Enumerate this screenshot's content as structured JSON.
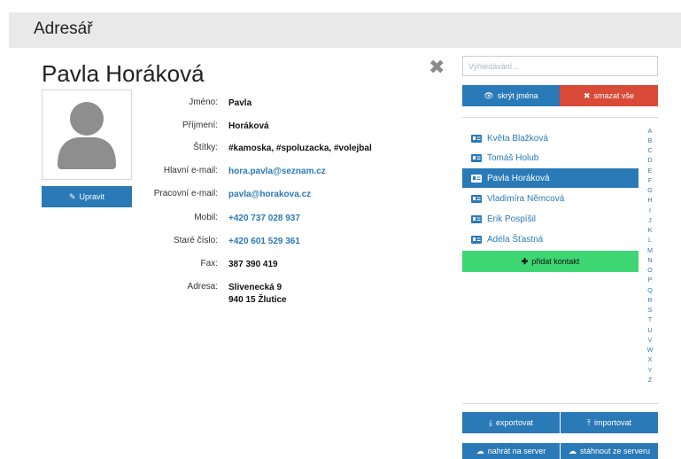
{
  "header": {
    "title": "Adresář"
  },
  "contact": {
    "name": "Pavla Horáková",
    "edit_label": "Upravit",
    "fields": [
      {
        "label": "Jméno:",
        "value": "Pavla",
        "link": false
      },
      {
        "label": "Příjmení:",
        "value": "Horáková",
        "link": false
      },
      {
        "label": "Štítky:",
        "value": "#kamoska, #spoluzacka, #volejbal",
        "link": false
      },
      {
        "label": "Hlavní e-mail:",
        "value": "hora.pavla@seznam.cz",
        "link": true
      },
      {
        "label": "Pracovní e-mail:",
        "value": "pavla@horakova.cz",
        "link": true
      },
      {
        "label": "Mobil:",
        "value": "+420 737 028 937",
        "link": true
      },
      {
        "label": "Staré číslo:",
        "value": "+420 601 529 361",
        "link": true
      },
      {
        "label": "Fax:",
        "value": "387 390 419",
        "link": false
      },
      {
        "label": "Adresa:",
        "value": "Slivenecká 9",
        "value2": "940 15 Žlutice",
        "link": false
      }
    ]
  },
  "sidebar": {
    "search_placeholder": "Vyhledávání...",
    "hide_names_label": "skrýt jména",
    "delete_all_label": "smazat vše",
    "contacts": [
      {
        "name": "Květa Blažková",
        "active": false
      },
      {
        "name": "Tomáš Holub",
        "active": false
      },
      {
        "name": "Pavla Horáková",
        "active": true
      },
      {
        "name": "Vladimíra Němcová",
        "active": false
      },
      {
        "name": "Erik Pospíšil",
        "active": false
      },
      {
        "name": "Adéla Šťastná",
        "active": false
      }
    ],
    "add_contact_label": "přidat kontakt",
    "alphabet": [
      "A",
      "B",
      "C",
      "D",
      "E",
      "F",
      "G",
      "H",
      "I",
      "J",
      "K",
      "L",
      "M",
      "N",
      "O",
      "P",
      "Q",
      "R",
      "S",
      "T",
      "U",
      "V",
      "W",
      "X",
      "Y",
      "Z"
    ],
    "export_label": "exportovat",
    "import_label": "importovat",
    "upload_label": "nahrát na server",
    "download_label": "stáhnout ze serveru"
  },
  "colors": {
    "primary": "#2a7ab8",
    "danger": "#d94a38",
    "success": "#3ed672",
    "header_bg": "#e9e9e9"
  }
}
